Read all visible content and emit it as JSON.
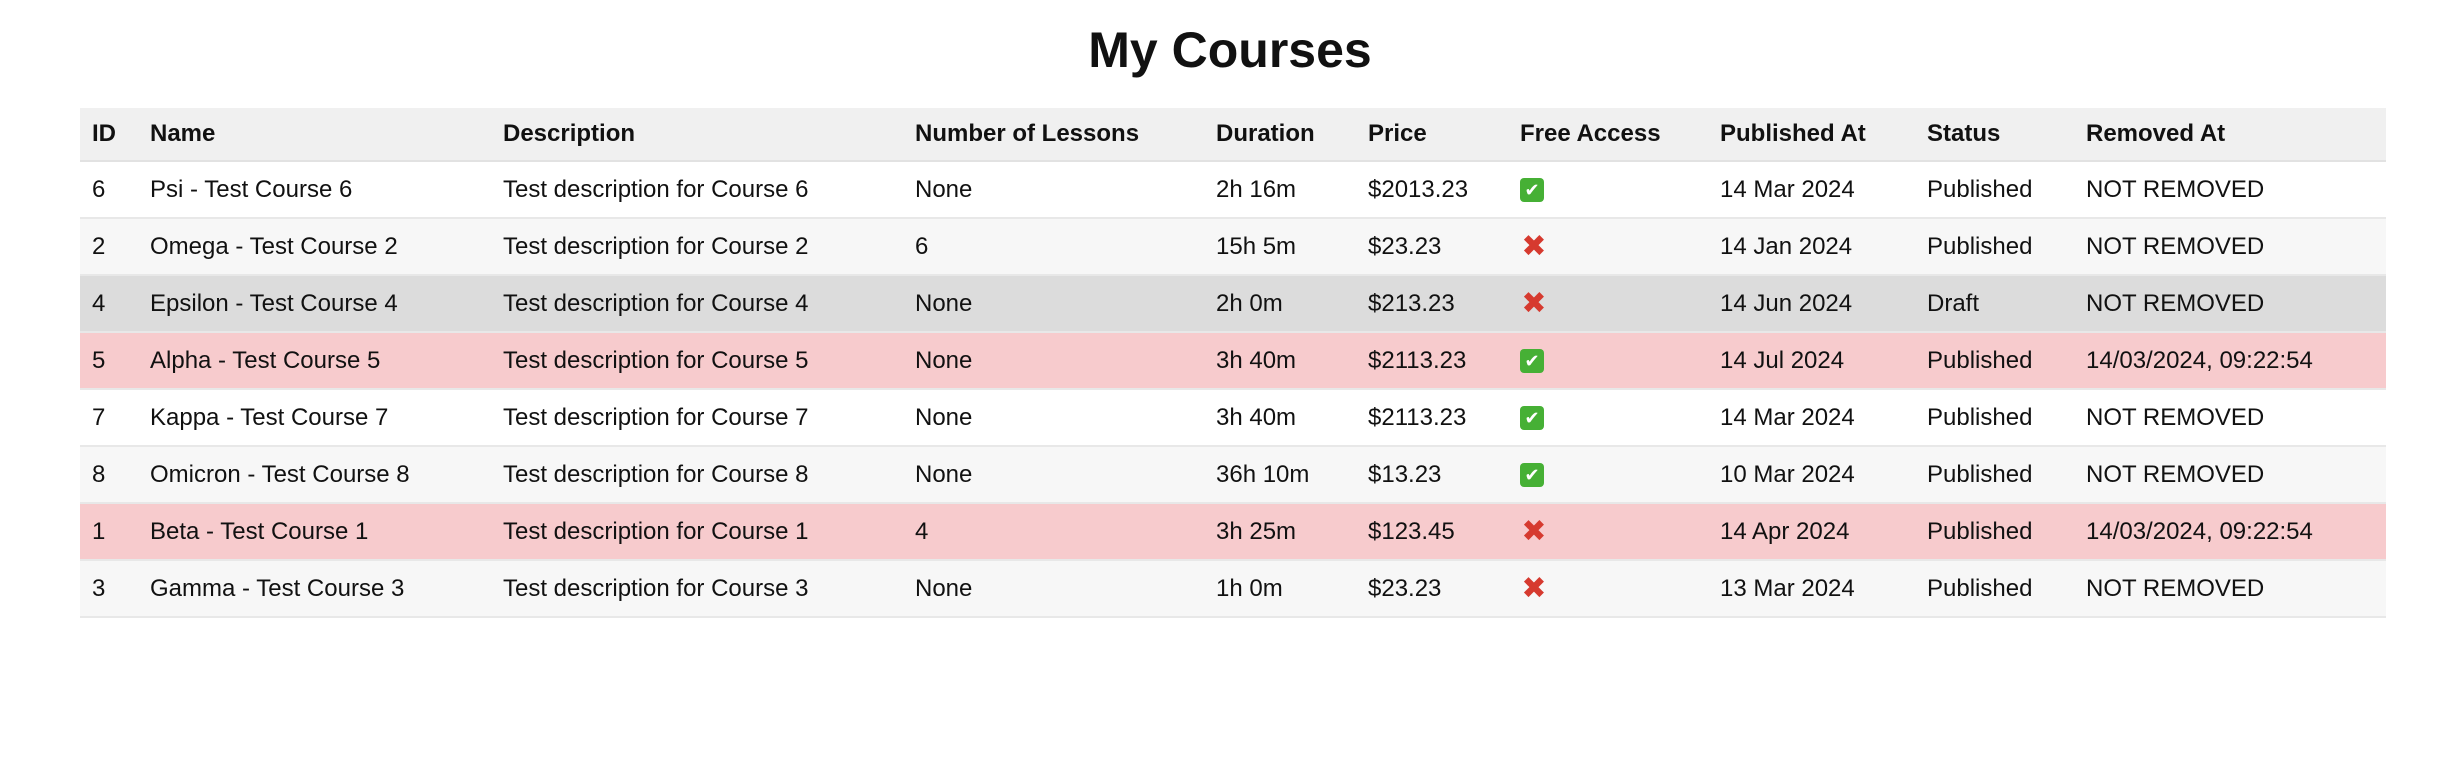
{
  "page": {
    "title": "My Courses"
  },
  "colors": {
    "header_bg": "#f0f0f0",
    "row_removed_bg": "#f7cbcd",
    "row_draft_bg": "#dcdcdc",
    "row_alt_bg": "#f7f7f7",
    "check_green": "#46b035",
    "cross_red": "#d63a2f"
  },
  "table": {
    "columns": [
      "ID",
      "Name",
      "Description",
      "Number of Lessons",
      "Duration",
      "Price",
      "Free Access",
      "Published At",
      "Status",
      "Removed At"
    ],
    "rows": [
      {
        "id": "6",
        "name": "Psi - Test Course 6",
        "description": "Test description for Course 6",
        "lessons": "None",
        "duration": "2h 16m",
        "price": "$2013.23",
        "free_access": true,
        "free_icon": "check-icon",
        "published_at": "14 Mar 2024",
        "status": "Published",
        "removed_at": "NOT REMOVED",
        "row_style": "plain"
      },
      {
        "id": "2",
        "name": "Omega - Test Course 2",
        "description": "Test description for Course 2",
        "lessons": "6",
        "duration": "15h 5m",
        "price": "$23.23",
        "free_access": false,
        "free_icon": "cross-icon",
        "published_at": "14 Jan 2024",
        "status": "Published",
        "removed_at": "NOT REMOVED",
        "row_style": "alt"
      },
      {
        "id": "4",
        "name": "Epsilon - Test Course 4",
        "description": "Test description for Course 4",
        "lessons": "None",
        "duration": "2h 0m",
        "price": "$213.23",
        "free_access": false,
        "free_icon": "cross-icon",
        "published_at": "14 Jun 2024",
        "status": "Draft",
        "removed_at": "NOT REMOVED",
        "row_style": "draft"
      },
      {
        "id": "5",
        "name": "Alpha - Test Course 5",
        "description": "Test description for Course 5",
        "lessons": "None",
        "duration": "3h 40m",
        "price": "$2113.23",
        "free_access": true,
        "free_icon": "check-icon",
        "published_at": "14 Jul 2024",
        "status": "Published",
        "removed_at": "14/03/2024, 09:22:54",
        "row_style": "removed"
      },
      {
        "id": "7",
        "name": "Kappa - Test Course 7",
        "description": "Test description for Course 7",
        "lessons": "None",
        "duration": "3h 40m",
        "price": "$2113.23",
        "free_access": true,
        "free_icon": "check-icon",
        "published_at": "14 Mar 2024",
        "status": "Published",
        "removed_at": "NOT REMOVED",
        "row_style": "plain"
      },
      {
        "id": "8",
        "name": "Omicron - Test Course 8",
        "description": "Test description for Course 8",
        "lessons": "None",
        "duration": "36h 10m",
        "price": "$13.23",
        "free_access": true,
        "free_icon": "check-icon",
        "published_at": "10 Mar 2024",
        "status": "Published",
        "removed_at": "NOT REMOVED",
        "row_style": "alt"
      },
      {
        "id": "1",
        "name": "Beta - Test Course 1",
        "description": "Test description for Course 1",
        "lessons": "4",
        "duration": "3h 25m",
        "price": "$123.45",
        "free_access": false,
        "free_icon": "cross-icon",
        "published_at": "14 Apr 2024",
        "status": "Published",
        "removed_at": "14/03/2024, 09:22:54",
        "row_style": "removed"
      },
      {
        "id": "3",
        "name": "Gamma - Test Course 3",
        "description": "Test description for Course 3",
        "lessons": "None",
        "duration": "1h 0m",
        "price": "$23.23",
        "free_access": false,
        "free_icon": "cross-icon",
        "published_at": "13 Mar 2024",
        "status": "Published",
        "removed_at": "NOT REMOVED",
        "row_style": "alt"
      }
    ]
  }
}
